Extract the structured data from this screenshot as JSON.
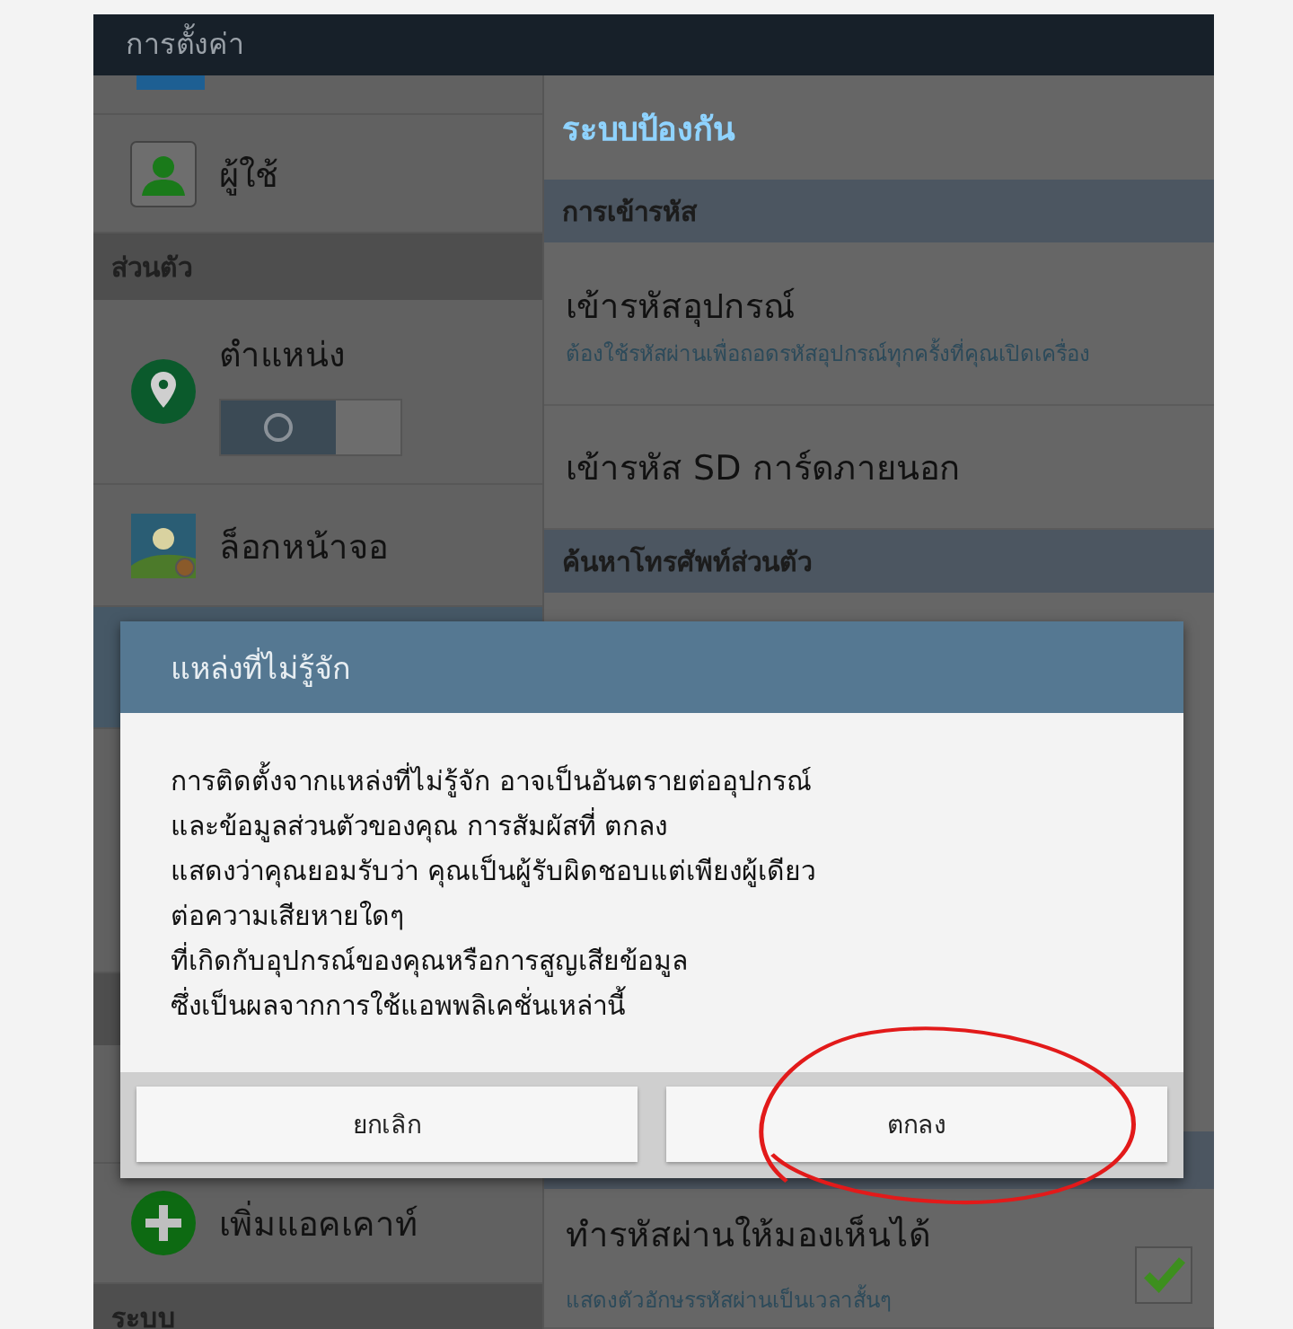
{
  "header": {
    "title": "การตั้งค่า"
  },
  "sidebar": {
    "items": [
      {
        "kind": "item",
        "label": "ผู้ใช้"
      },
      {
        "kind": "section",
        "label": "ส่วนตัว"
      },
      {
        "kind": "toggle_item",
        "label": "ตำแหน่ง",
        "on": false
      },
      {
        "kind": "item",
        "label": "ล็อกหน้าจอ"
      },
      {
        "kind": "item",
        "label": "เพิ่มแอคเคาท์"
      },
      {
        "kind": "section",
        "label": "ระบบ"
      }
    ]
  },
  "content": {
    "title": "ระบบป้องกัน",
    "items": [
      {
        "kind": "section",
        "label": "การเข้ารหัส"
      },
      {
        "kind": "item",
        "label": "เข้ารหัสอุปกรณ์",
        "summary": "ต้องใช้รหัสผ่านเพื่อถอดรหัสอุปกรณ์ทุกครั้งที่คุณเปิดเครื่อง"
      },
      {
        "kind": "item",
        "label": "เข้ารหัส SD การ์ดภายนอก"
      },
      {
        "kind": "section",
        "label": "ค้นหาโทรศัพท์ส่วนตัว"
      },
      {
        "kind": "check_item",
        "label": "ทำรหัสผ่านให้มองเห็นได้",
        "summary": "แสดงตัวอักษรรหัสผ่านเป็นเวลาสั้นๆ",
        "checked": true
      }
    ]
  },
  "dialog": {
    "title": "แหล่งที่ไม่รู้จัก",
    "message": [
      "การติดตั้งจากแหล่งที่ไม่รู้จัก อาจเป็นอันตรายต่ออุปกรณ์",
      "และข้อมูลส่วนตัวของคุณ การสัมผัสที่ ตกลง",
      "แสดงว่าคุณยอมรับว่า คุณเป็นผู้รับผิดชอบแต่เพียงผู้เดียว",
      "ต่อความเสียหายใดๆ",
      "ที่เกิดกับอุปกรณ์ของคุณหรือการสูญเสียข้อมูล",
      "ซึ่งเป็นผลจากการใช้แอพพลิเคชั่นเหล่านี้"
    ],
    "buttons": [
      "ยกเลิก",
      "ตกลง"
    ]
  }
}
